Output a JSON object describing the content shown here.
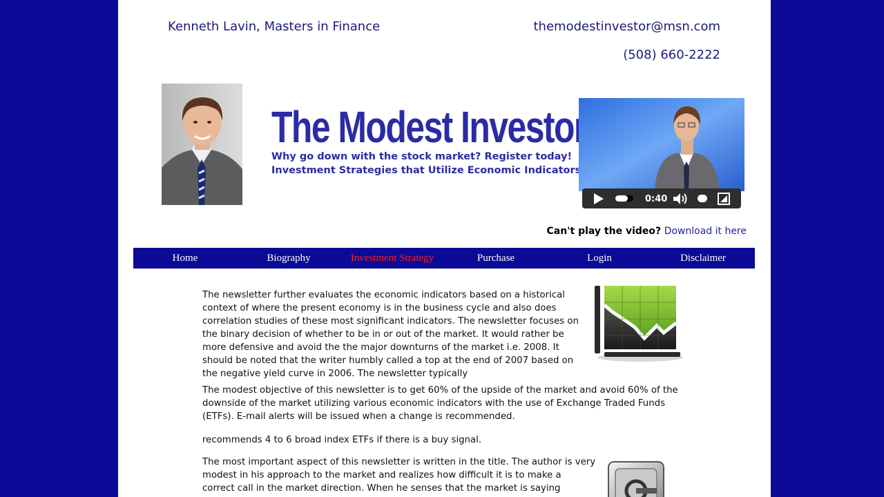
{
  "header": {
    "name": "Kenneth Lavin, Masters in Finance",
    "email": "themodestinvestor@msn.com",
    "phone": "(508) 660-2222"
  },
  "banner": {
    "title": "The Modest Investor",
    "tagline_1": "Why go down  with the stock market? Register today!",
    "tagline_2": "Investment Strategies that Utilize Economic Indicators."
  },
  "video": {
    "time": "0:40",
    "cant_play_label": "Can't play the video?",
    "download_link": "Download it here"
  },
  "nav": {
    "items": [
      {
        "label": "Home"
      },
      {
        "label": "Biography"
      },
      {
        "label": "Investment Strategy"
      },
      {
        "label": "Purchase"
      },
      {
        "label": "Login"
      },
      {
        "label": "Disclaimer"
      }
    ],
    "active_index": 2,
    "active_color": "#ff1f1f",
    "bar_color": "#0a0a96"
  },
  "content": {
    "p1": "The newsletter further evaluates the economic indicators based on a historical context of where the present economy is in the business cycle and also does correlation studies of these most significant indicators. The newsletter focuses on the binary decision of whether to be in or out of the market. It would rather be more defensive and avoid the the major downturns of the market i.e. 2008. It should be noted that the writer humbly called a top at the end of 2007 based on the negative yield curve in 2006. The newsletter typically",
    "p2": "The modest objective of this newsletter is to get 60% of the upside of the market and avoid 60% of the downside of the market utilizing various economic indicators with the use of Exchange Traded Funds (ETFs). E-mail alerts will be issued when a change is recommended.",
    "p3": "recommends 4 to 6 broad index ETFs if there is a buy signal.",
    "p4": "The most important aspect of this newsletter is written in the title. The author is very modest in his approach to the market and realizes how difficult it is to make a correct call in the market direction. When he senses that the market is saying something different than"
  },
  "colors": {
    "page_background": "#0a0a96",
    "title_blue": "#2b2ba6",
    "header_text": "#1a1a7a"
  }
}
